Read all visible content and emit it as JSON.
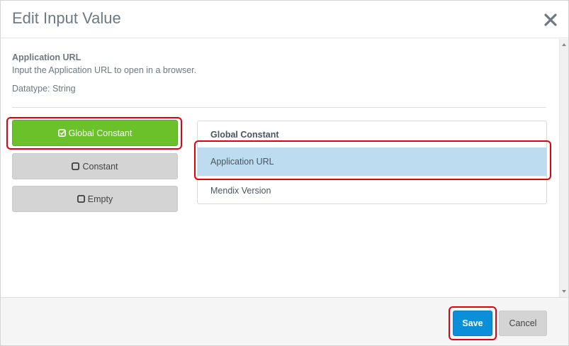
{
  "dialog": {
    "title": "Edit Input Value",
    "close_icon": "close-icon"
  },
  "parameter": {
    "name": "Application URL",
    "description": "Input the Application URL to open in a browser.",
    "datatype": "Datatype: String"
  },
  "options": [
    {
      "label": "Global Constant",
      "selected": true,
      "icon": "checked-square-icon"
    },
    {
      "label": "Constant",
      "selected": false,
      "icon": "empty-square-icon"
    },
    {
      "label": "Empty",
      "selected": false,
      "icon": "empty-square-icon"
    }
  ],
  "list": {
    "header": "Global Constant",
    "items": [
      {
        "label": "Application URL",
        "selected": true
      },
      {
        "label": "Mendix Version",
        "selected": false
      }
    ]
  },
  "footer": {
    "save_label": "Save",
    "cancel_label": "Cancel"
  },
  "colors": {
    "accent_green": "#6ac12a",
    "primary_blue": "#0b8fd8",
    "selected_row": "#bddcef",
    "highlight_red": "#e3000b"
  }
}
